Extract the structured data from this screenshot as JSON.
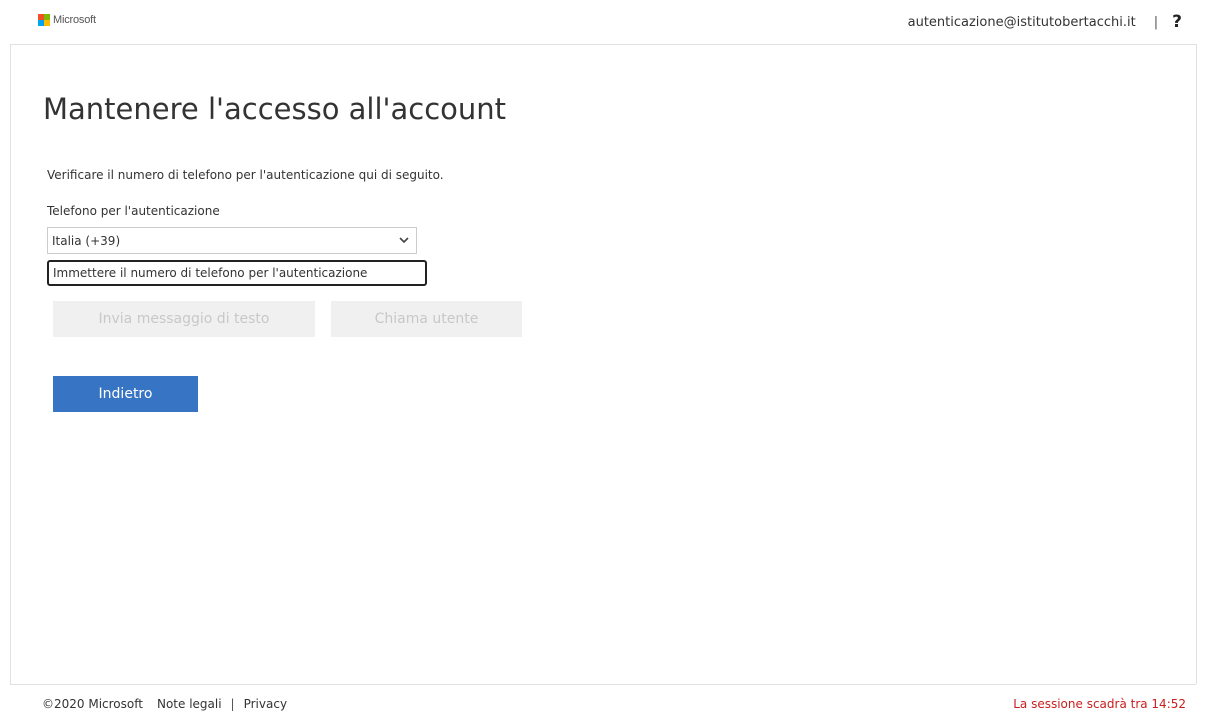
{
  "header": {
    "brand": "Microsoft",
    "account": "autenticazione@istitutobertacchi.it",
    "separator": "|",
    "help": "?"
  },
  "colors": {
    "logo_red": "#f25022",
    "logo_green": "#7fba00",
    "logo_blue": "#00a4ef",
    "logo_yellow": "#ffb900",
    "primary_button": "#3775c4",
    "session_text": "#c8201f"
  },
  "main": {
    "title": "Mantenere l'accesso all'account",
    "description": "Verificare il numero di telefono per l'autenticazione qui di seguito.",
    "phone_label": "Telefono per l'autenticazione",
    "country_value": "Italia (+39)",
    "phone_placeholder": "Immettere il numero di telefono per l'autenticazione",
    "sms_button": "Invia messaggio di testo",
    "call_button": "Chiama utente",
    "back_button": "Indietro"
  },
  "footer": {
    "copyright": "©2020 Microsoft",
    "legal": "Note legali",
    "separator": "|",
    "privacy": "Privacy",
    "session": "La sessione scadrà tra 14:52"
  },
  "icons": {
    "logo": "microsoft-logo-icon",
    "dropdown": "chevron-down-icon",
    "help": "help-icon"
  }
}
